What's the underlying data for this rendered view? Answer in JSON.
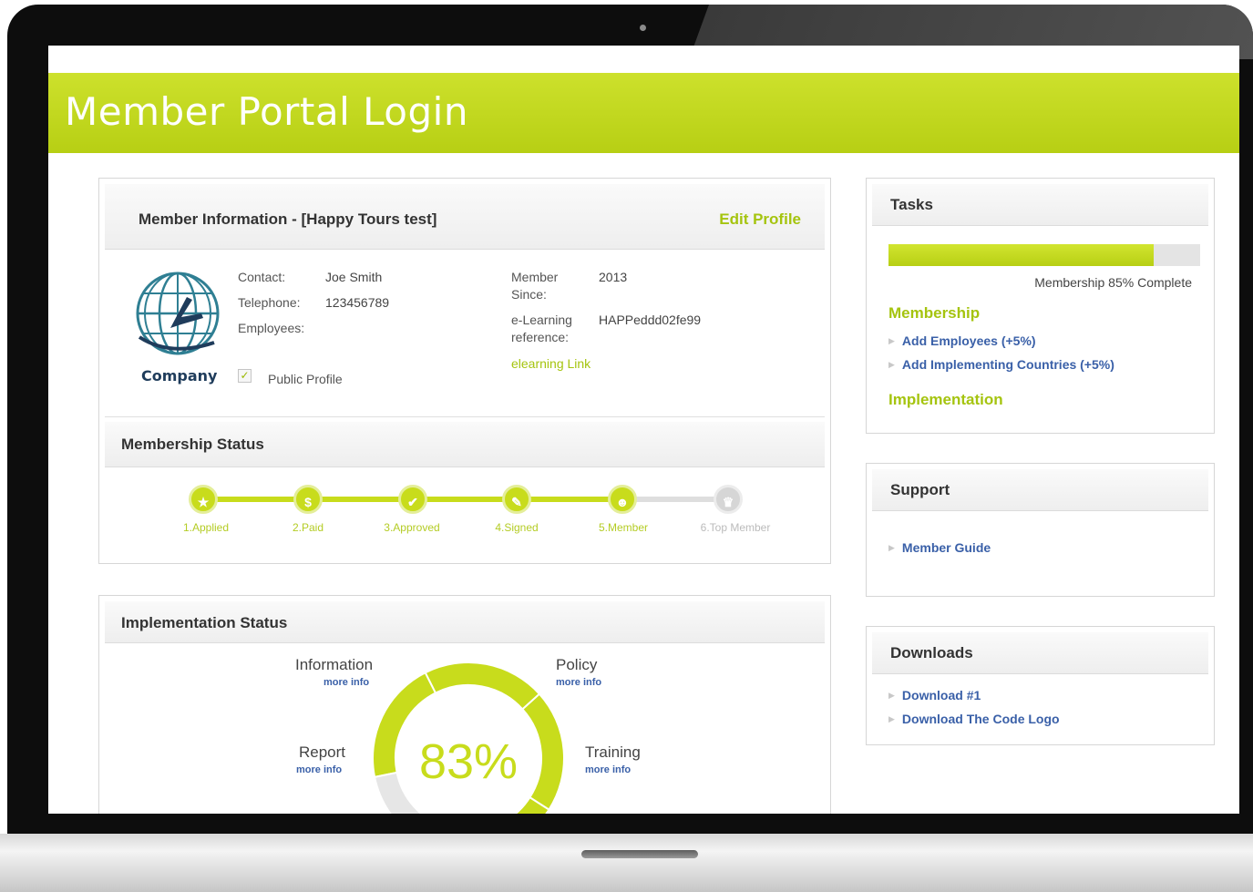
{
  "header": {
    "title": "Member Portal Login"
  },
  "member_info": {
    "title": "Member Information - [Happy Tours test]",
    "edit_link": "Edit Profile",
    "company_label": "Company",
    "contact_label": "Contact:",
    "contact_value": "Joe Smith",
    "telephone_label": "Telephone:",
    "telephone_value": "123456789",
    "employees_label": "Employees:",
    "member_since_label": "Member Since:",
    "member_since_value": "2013",
    "elearning_label": "e-Learning reference:",
    "elearning_value": "HAPPeddd02fe99",
    "elearning_link": "elearning Link",
    "public_profile_label": "Public Profile",
    "public_profile_checked": true
  },
  "membership_status": {
    "title": "Membership Status",
    "steps": [
      {
        "label": "1.Applied",
        "icon": "star-icon",
        "glyph": "★",
        "complete": true
      },
      {
        "label": "2.Paid",
        "icon": "dollar-icon",
        "glyph": "$",
        "complete": true
      },
      {
        "label": "3.Approved",
        "icon": "checkmark-icon",
        "glyph": "✔",
        "complete": true
      },
      {
        "label": "4.Signed",
        "icon": "pen-icon",
        "glyph": "✎",
        "complete": true
      },
      {
        "label": "5.Member",
        "icon": "person-icon",
        "glyph": "☻",
        "complete": true
      },
      {
        "label": "6.Top Member",
        "icon": "trophy-icon",
        "glyph": "♛",
        "complete": false
      }
    ]
  },
  "implementation_status": {
    "title": "Implementation Status",
    "percent_label": "83%",
    "percent": 83,
    "items": [
      {
        "label": "Information",
        "more": "more info"
      },
      {
        "label": "Policy",
        "more": "more info"
      },
      {
        "label": "Report",
        "more": "more info"
      },
      {
        "label": "Training",
        "more": "more info"
      }
    ],
    "colors": {
      "done": "#c8dc1c",
      "todo": "#e6e6e6"
    }
  },
  "tasks": {
    "title": "Tasks",
    "progress": 0.85,
    "progress_text": "Membership 85% Complete",
    "membership_heading": "Membership",
    "membership_items": [
      "Add Employees (+5%)",
      "Add Implementing Countries (+5%)"
    ],
    "implementation_heading": "Implementation"
  },
  "support": {
    "title": "Support",
    "items": [
      "Member Guide"
    ]
  },
  "downloads": {
    "title": "Downloads",
    "items": [
      "Download #1",
      "Download The Code Logo"
    ]
  },
  "colors": {
    "accent": "#b7cf14",
    "link_blue": "#3a60a8"
  }
}
